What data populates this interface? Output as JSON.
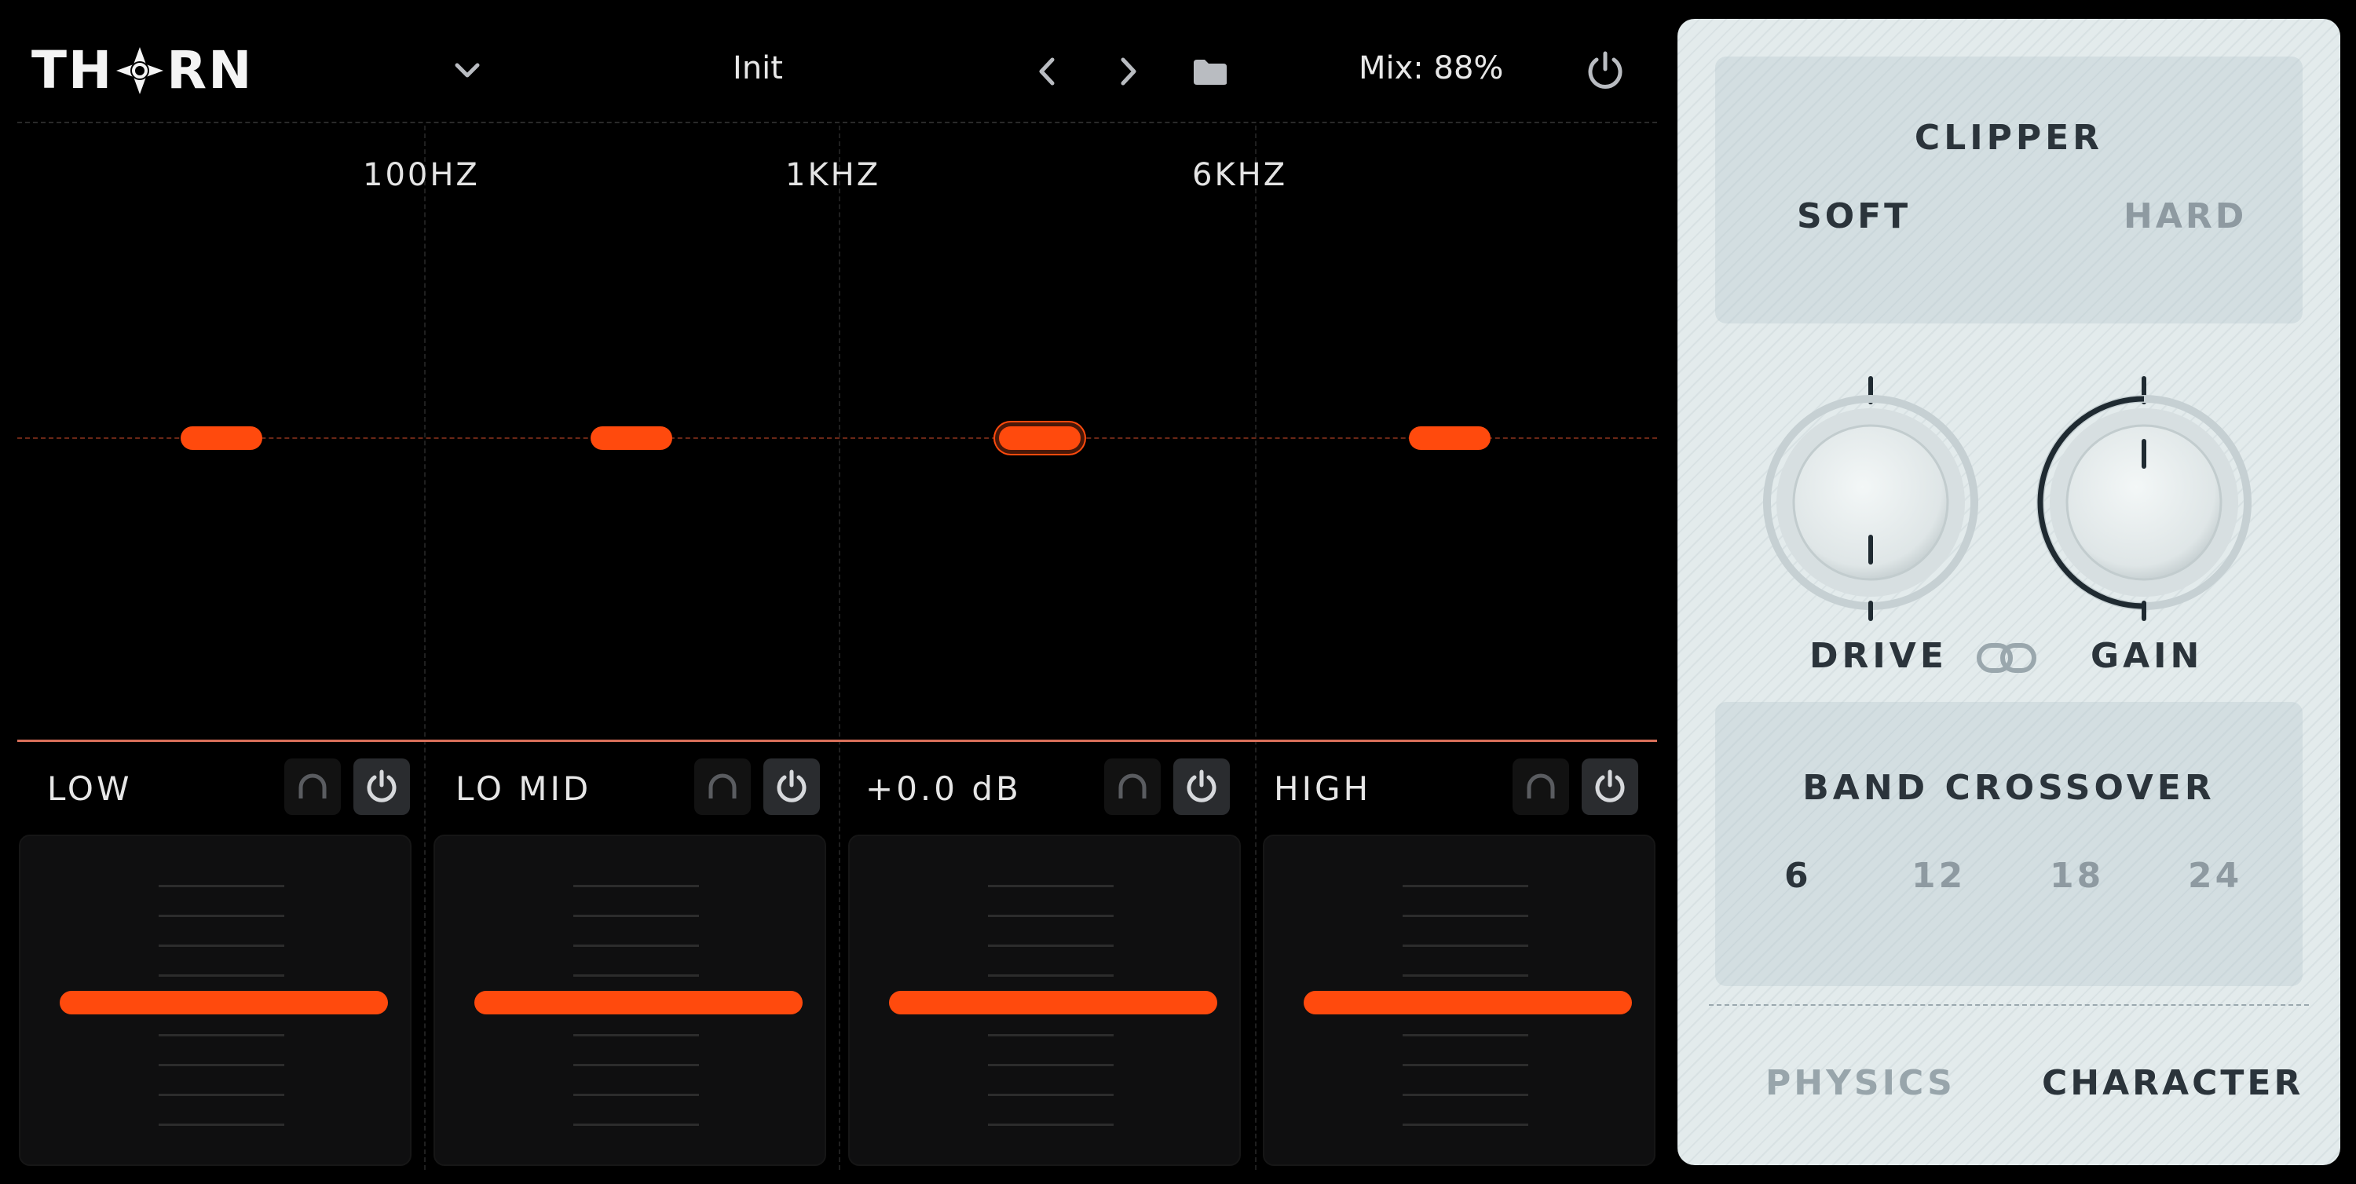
{
  "header": {
    "logo_text": "THORN",
    "preset_name": "Init",
    "mix_label": "Mix: 88%"
  },
  "graph": {
    "frequency_labels": [
      "100HZ",
      "1KHZ",
      "6KHZ"
    ]
  },
  "bands": [
    {
      "label": "LOW"
    },
    {
      "label": "LO MID"
    },
    {
      "label": "+0.0 dB"
    },
    {
      "label": "HIGH"
    }
  ],
  "colors": {
    "accent": "#ff4a0d",
    "background": "#000000",
    "panel": "#e3ebec",
    "text_dark": "#2b343b",
    "text_inactive": "#8e9aa1"
  },
  "clipper": {
    "title": "CLIPPER",
    "soft": "SOFT",
    "hard": "HARD",
    "selected": "SOFT"
  },
  "knobs": {
    "drive": "DRIVE",
    "gain": "GAIN"
  },
  "crossover": {
    "title": "BAND CROSSOVER",
    "options": [
      "6",
      "12",
      "18",
      "24"
    ],
    "selected": "6"
  },
  "tabs": {
    "physics": "PHYSICS",
    "character": "CHARACTER",
    "active": "CHARACTER"
  },
  "icons": [
    "chevron-down-icon",
    "chevron-left-icon",
    "chevron-right-icon",
    "folder-icon",
    "power-icon",
    "headphones-icon",
    "link-icon"
  ]
}
